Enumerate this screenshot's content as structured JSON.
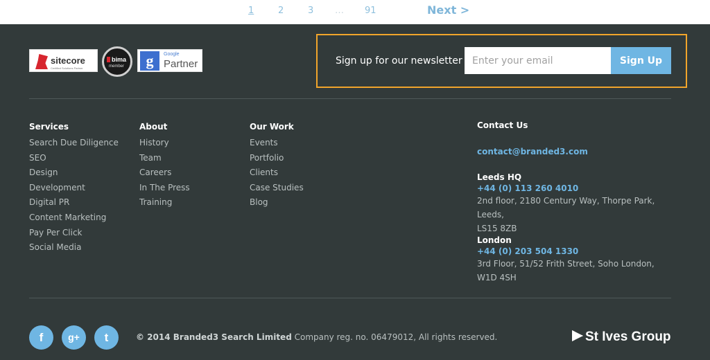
{
  "pagination": {
    "pages": [
      "1",
      "2",
      "3",
      "…",
      "91"
    ],
    "next": "Next >"
  },
  "badges": {
    "sitecore": {
      "name": "sitecore",
      "sub": "Certified Solutions Partner"
    },
    "bima": {
      "name": "bima",
      "sub": "member"
    },
    "google": {
      "small": "Google",
      "big": "Partner"
    }
  },
  "newsletter": {
    "label": "Sign up for our newsletter",
    "placeholder": "Enter your email",
    "button": "Sign Up"
  },
  "columns": [
    {
      "heading": "Services",
      "links": [
        "Search Due Diligence",
        "SEO",
        "Design",
        "Development",
        "Digital PR",
        "Content Marketing",
        "Pay Per Click",
        "Social Media"
      ]
    },
    {
      "heading": "About",
      "links": [
        "History",
        "Team",
        "Careers",
        "In The Press",
        "Training"
      ]
    },
    {
      "heading": "Our Work",
      "links": [
        "Events",
        "Portfolio",
        "Clients",
        "Case Studies",
        "Blog"
      ]
    }
  ],
  "contact": {
    "heading": "Contact Us",
    "email": "contact@branded3.com",
    "leeds": {
      "title": "Leeds HQ",
      "phone": "+44 (0) 113 260 4010",
      "address1": "2nd floor, 2180 Century Way, Thorpe Park, Leeds,",
      "address2": "LS15 8ZB"
    },
    "london": {
      "title": "London",
      "phone": "+44 (0) 203 504 1330",
      "address1": "3rd Floor, 51/52 Frith Street, Soho London,",
      "address2": "W1D 4SH"
    }
  },
  "footer": {
    "social": {
      "facebook": "f",
      "google": "g+",
      "twitter": "t"
    },
    "copy_bold": "© 2014 Branded3 Search Limited",
    "copy_rest": " Company reg. no. 06479012, All rights reserved.",
    "brand": "St Ives Group"
  },
  "colors": {
    "background": "#323a3a",
    "accent": "#6fb6e3",
    "highlight": "#f2a52b"
  }
}
